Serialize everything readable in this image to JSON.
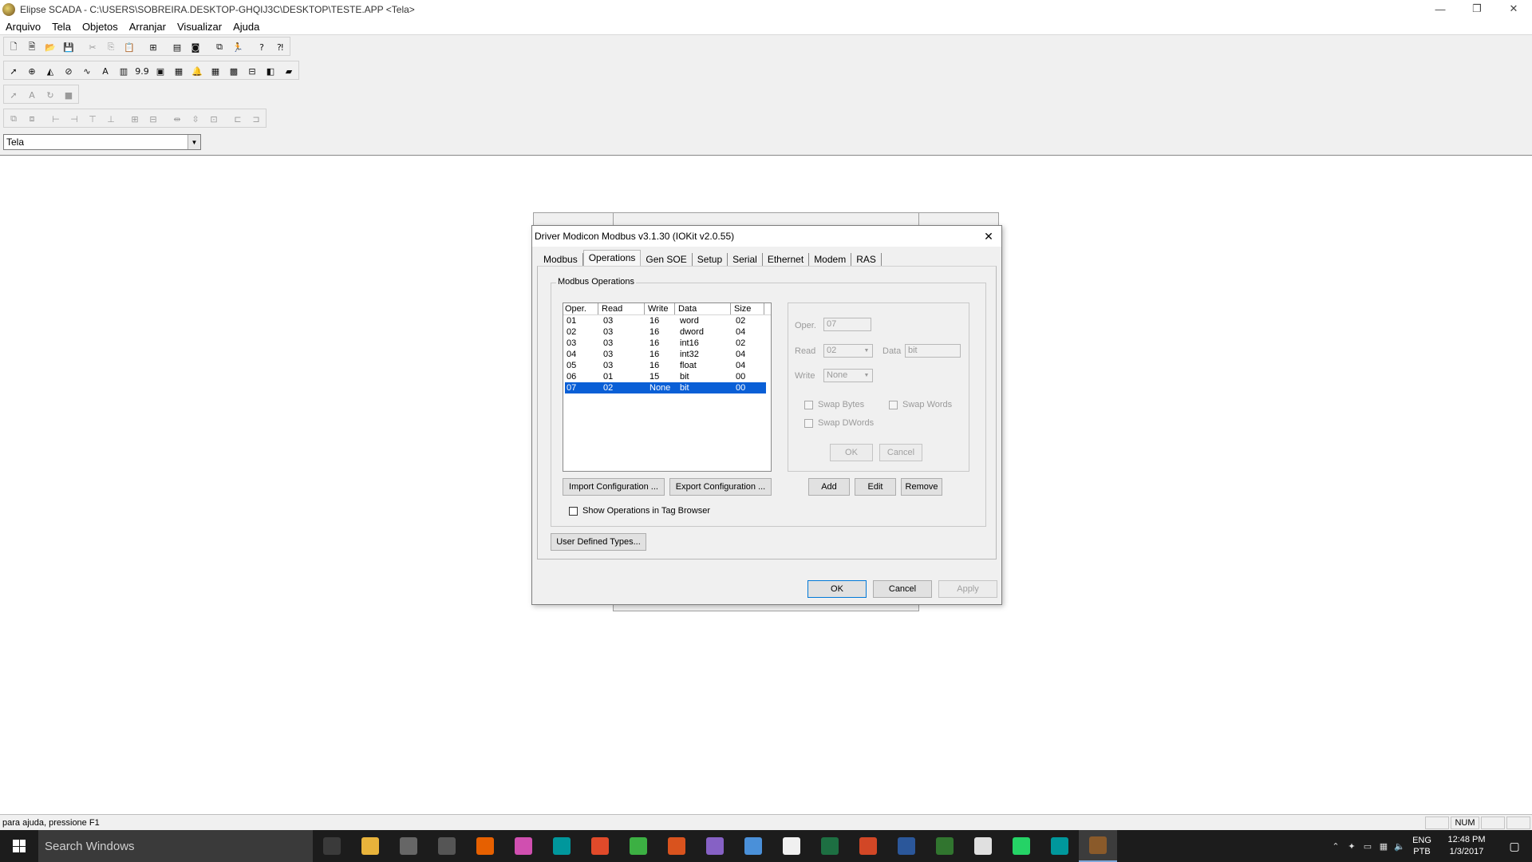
{
  "window": {
    "title": "Elipse SCADA - C:\\USERS\\SOBREIRA.DESKTOP-GHQIJ3C\\DESKTOP\\TESTE.APP <Tela>",
    "minimize_glyph": "—",
    "restore_glyph": "❐",
    "close_glyph": "✕"
  },
  "menu": [
    "Arquivo",
    "Tela",
    "Objetos",
    "Arranjar",
    "Visualizar",
    "Ajuda"
  ],
  "toolbar": {
    "row1": [
      "new-file-icon",
      "open-icon",
      "folder-icon",
      "save-icon",
      "cut-icon",
      "copy-icon",
      "paste-icon",
      "organizer-icon",
      "properties-icon",
      "camera-icon",
      "graph-icon",
      "run-icon",
      "help-icon",
      "context-help-icon"
    ],
    "row2": [
      "select-icon",
      "button-icon",
      "gauge-icon",
      "display-icon",
      "trend-icon",
      "text-icon",
      "bar-icon",
      "number-icon",
      "slider-icon",
      "grid-icon",
      "alarm-icon",
      "table-icon",
      "picture-icon",
      "setpoint-icon",
      "browser-icon",
      "tank-icon"
    ],
    "row2_labels": {
      "text": "A",
      "number": "9.9"
    },
    "row3_labels": {
      "text": "A"
    },
    "screen_select": "Tela"
  },
  "dialog": {
    "title": "Driver Modicon Modbus v3.1.30 (IOKit v2.0.55)",
    "close_glyph": "✕",
    "tabs": [
      "Modbus",
      "Operations",
      "Gen SOE",
      "Setup",
      "Serial",
      "Ethernet",
      "Modem",
      "RAS"
    ],
    "active_tab": "Operations",
    "group_label": "Modbus Operations",
    "columns": [
      "Oper.",
      "Read",
      "Write",
      "Data",
      "Size"
    ],
    "rows": [
      {
        "oper": "01",
        "read": "03",
        "write": "16",
        "data": "word",
        "size": "02"
      },
      {
        "oper": "02",
        "read": "03",
        "write": "16",
        "data": "dword",
        "size": "04"
      },
      {
        "oper": "03",
        "read": "03",
        "write": "16",
        "data": "int16",
        "size": "02"
      },
      {
        "oper": "04",
        "read": "03",
        "write": "16",
        "data": "int32",
        "size": "04"
      },
      {
        "oper": "05",
        "read": "03",
        "write": "16",
        "data": "float",
        "size": "04"
      },
      {
        "oper": "06",
        "read": "01",
        "write": "15",
        "data": "bit",
        "size": "00"
      },
      {
        "oper": "07",
        "read": "02",
        "write": "None",
        "data": "bit",
        "size": "00"
      }
    ],
    "selected_row": 6,
    "edit": {
      "oper_label": "Oper.",
      "oper_value": "07",
      "read_label": "Read",
      "read_value": "02",
      "data_label": "Data",
      "data_value": "bit",
      "write_label": "Write",
      "write_value": "None",
      "swap_bytes": "Swap Bytes",
      "swap_words": "Swap Words",
      "swap_dwords": "Swap DWords",
      "ok": "OK",
      "cancel": "Cancel"
    },
    "import_btn": "Import Configuration ...",
    "export_btn": "Export Configuration ...",
    "add_btn": "Add",
    "edit_btn": "Edit",
    "remove_btn": "Remove",
    "show_ops_label": "Show Operations in Tag Browser",
    "user_types_btn": "User Defined Types...",
    "ok_btn": "OK",
    "cancel_btn": "Cancel",
    "apply_btn": "Apply"
  },
  "status": {
    "text": "para ajuda, pressione F1",
    "num": "NUM"
  },
  "taskbar": {
    "search_placeholder": "Search Windows",
    "apps": [
      "task-view-icon",
      "file-explorer-icon",
      "calculator-icon",
      "phone-icon",
      "firefox-icon",
      "itunes-icon",
      "arduino-icon",
      "app-icon",
      "office-icon",
      "matlab-icon",
      "vs-icon",
      "notes-icon",
      "cards-icon",
      "excel-icon",
      "powerpoint-icon",
      "word-icon",
      "project-icon",
      "paint-icon",
      "whatsapp-icon",
      "arduino2-icon",
      "elipse-icon"
    ],
    "app_colors": [
      "#3a3a3a",
      "#e8b33b",
      "#666666",
      "#555555",
      "#e66000",
      "#d04fb0",
      "#00979c",
      "#e04a2a",
      "#3cb043",
      "#d9531e",
      "#8661c5",
      "#4a90d9",
      "#f0f0f0",
      "#1d6f42",
      "#d24726",
      "#2b579a",
      "#31752f",
      "#e0e0e0",
      "#25d366",
      "#00979c",
      "#8a5a2a"
    ],
    "lang_top": "ENG",
    "lang_bottom": "PTB",
    "time": "12:48 PM",
    "date": "1/3/2017"
  }
}
